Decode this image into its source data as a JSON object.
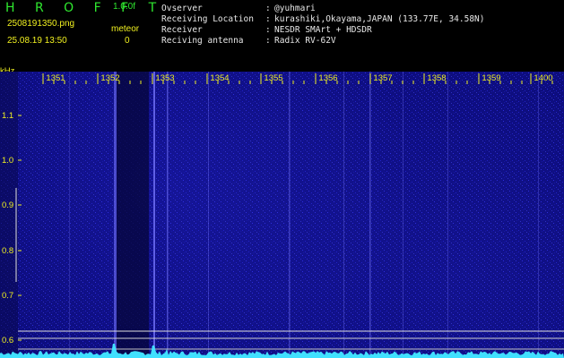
{
  "header": {
    "app_title": "H R O F F T",
    "version": "1.0.0f",
    "file_name": "2508191350.png",
    "date_time": "25.08.19 13:50",
    "meteor_label": "meteor",
    "meteor_count": "0",
    "info": [
      {
        "label": "Ovserver",
        "value": "@yuhmari"
      },
      {
        "label": "Receiving Location",
        "value": "kurashiki,Okayama,JAPAN (133.77E, 34.58N)"
      },
      {
        "label": "Receiver",
        "value": "NESDR SMArt + HDSDR"
      },
      {
        "label": "Reciving antenna",
        "value": "Radix RV-62V"
      }
    ],
    "separator": ":"
  },
  "axis": {
    "y_unit": "kHz",
    "freq_labels": [
      "1351",
      "1352",
      "1353",
      "1354",
      "1355",
      "1356",
      "1357",
      "1358",
      "1359",
      "1400"
    ],
    "y_labels": [
      "1.1",
      "1.0",
      "0.9",
      "0.8",
      "0.7",
      "0.6"
    ]
  },
  "colors": {
    "background": "#0b0b78",
    "signal_cyan": "#40e0ff",
    "tick_yellow": "#f0f020",
    "text_green": "#2fe82f"
  }
}
